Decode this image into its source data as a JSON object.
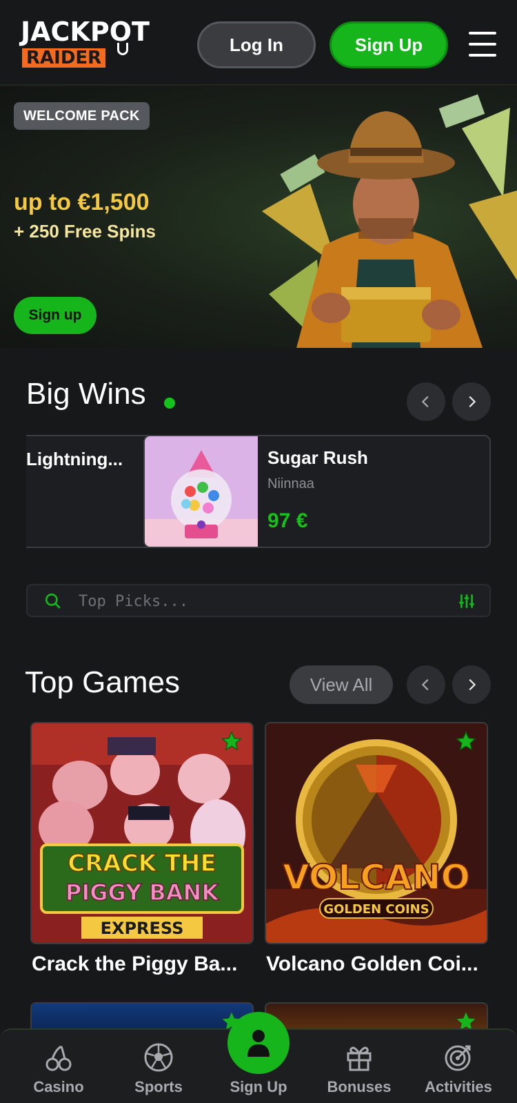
{
  "header": {
    "logo_top": "JACKPOT",
    "logo_bottom": "RAIDER",
    "login_label": "Log In",
    "signup_label": "Sign Up"
  },
  "banner": {
    "badge": "WELCOME PACK",
    "line1": "up to €1,500",
    "line2": "+ 250 Free Spins",
    "cta": "Sign up"
  },
  "big_wins": {
    "title": "Big Wins",
    "items": [
      {
        "game": "Lightning...",
        "user": "",
        "amount": ""
      },
      {
        "game": "Sugar Rush",
        "user": "Niinnaa",
        "amount": "97 €"
      }
    ]
  },
  "search": {
    "placeholder": "Top Picks..."
  },
  "top_games": {
    "title": "Top Games",
    "view_all": "View All",
    "games": [
      {
        "title": "Crack the Piggy Ba...",
        "art_line1": "CRACK THE",
        "art_line2": "PIGGY BANK",
        "art_line3": "EXPRESS"
      },
      {
        "title": "Volcano Golden Coi...",
        "art_line1": "VOLCANO",
        "art_line2": "GOLDEN COINS"
      }
    ]
  },
  "bottom_nav": {
    "items": [
      {
        "label": "Casino",
        "icon": "cherry-icon"
      },
      {
        "label": "Sports",
        "icon": "soccer-ball-icon"
      },
      {
        "label": "Sign Up",
        "icon": "user-icon"
      },
      {
        "label": "Bonuses",
        "icon": "gift-icon"
      },
      {
        "label": "Activities",
        "icon": "target-icon"
      }
    ]
  },
  "colors": {
    "accent_green": "#15b51b",
    "background": "#17181a",
    "gold": "#f5c842"
  }
}
